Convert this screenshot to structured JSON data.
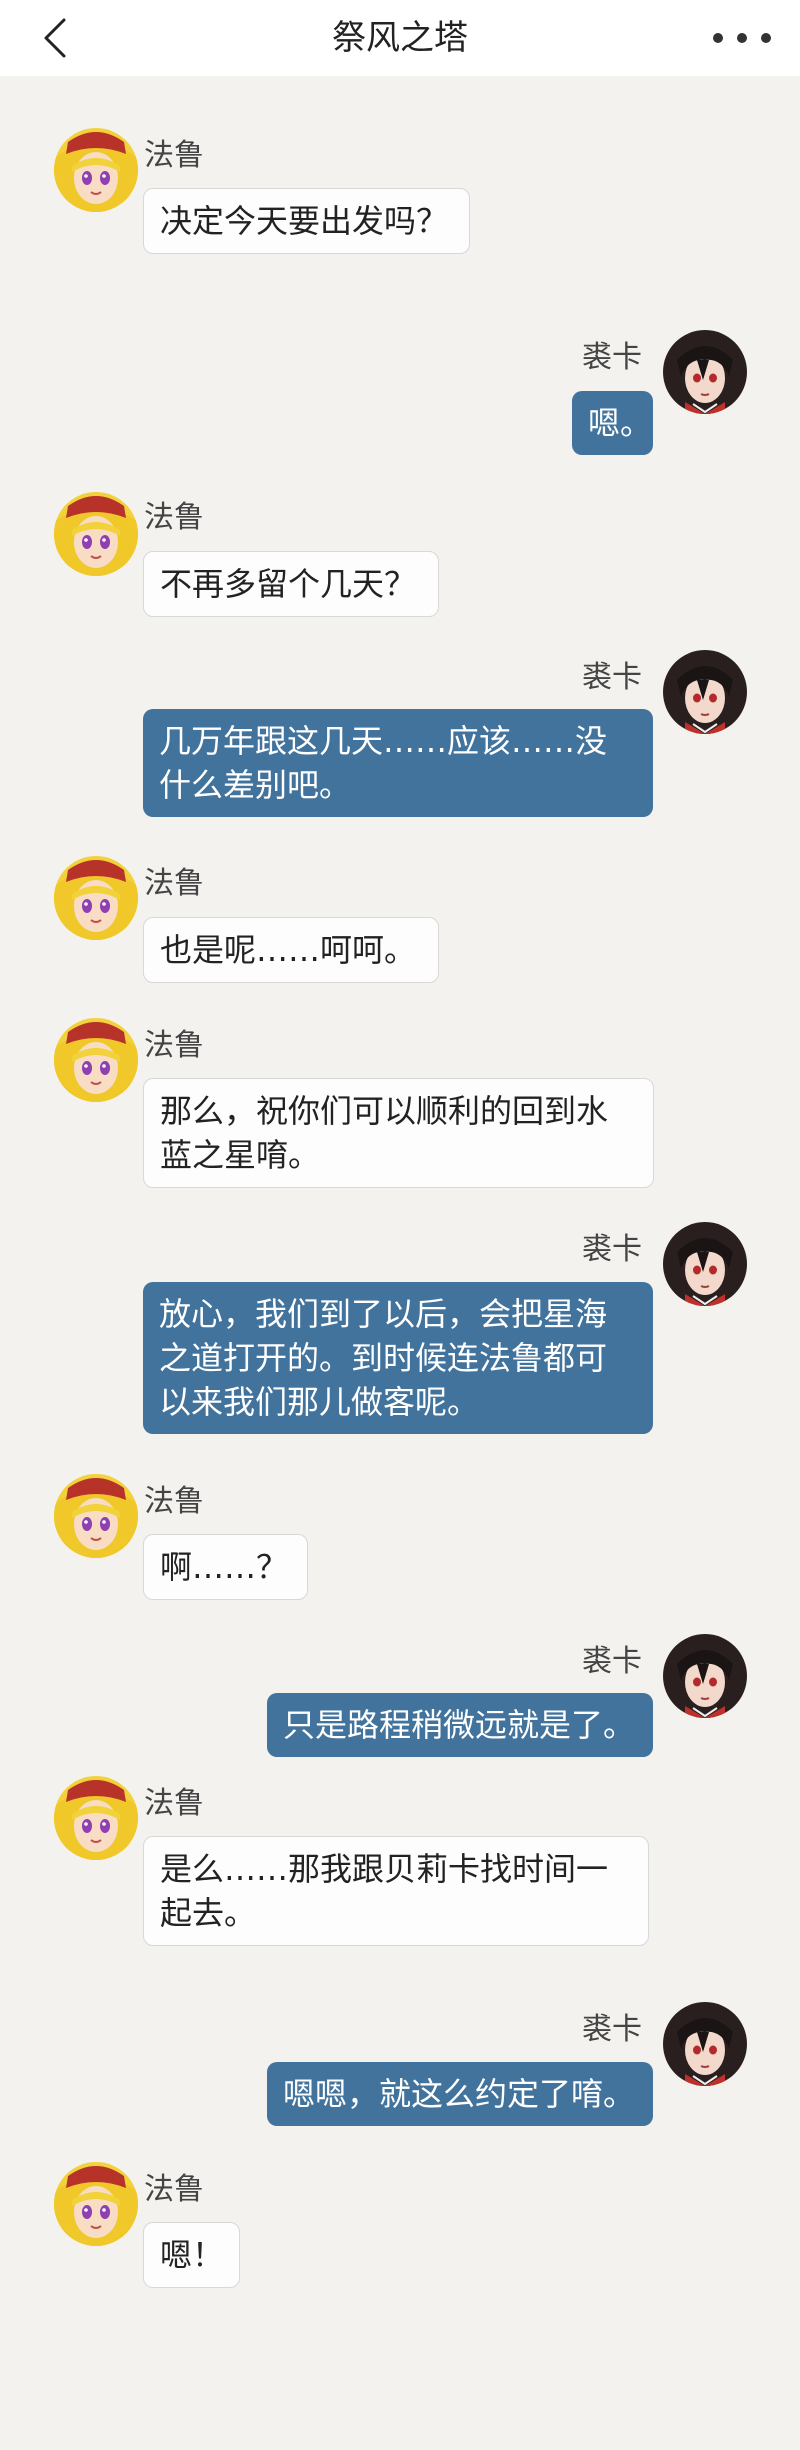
{
  "header": {
    "title": "祭风之塔",
    "back_icon": "chevron-left-icon",
    "more_icon": "more-dots-icon"
  },
  "colors": {
    "background": "#f3f2ee",
    "right_bubble": "#42739c",
    "left_bubble": "#fdfdfd"
  },
  "messages": [
    {
      "side": "left",
      "sender": "法鲁",
      "text": "决定今天要出发吗？"
    },
    {
      "side": "right",
      "sender": "裘卡",
      "text": "嗯。"
    },
    {
      "side": "left",
      "sender": "法鲁",
      "text": "不再多留个几天？"
    },
    {
      "side": "right",
      "sender": "裘卡",
      "text": "几万年跟这几天……应该……没什么差别吧。"
    },
    {
      "side": "left",
      "sender": "法鲁",
      "text": "也是呢……呵呵。"
    },
    {
      "side": "left",
      "sender": "法鲁",
      "text": "那么，祝你们可以顺利的回到水蓝之星唷。"
    },
    {
      "side": "right",
      "sender": "裘卡",
      "text": "放心，我们到了以后，会把星海之道打开的。到时候连法鲁都可以来我们那儿做客呢。"
    },
    {
      "side": "left",
      "sender": "法鲁",
      "text": "啊……？"
    },
    {
      "side": "right",
      "sender": "裘卡",
      "text": "只是路程稍微远就是了。"
    },
    {
      "side": "left",
      "sender": "法鲁",
      "text": "是么……那我跟贝莉卡找时间一起去。"
    },
    {
      "side": "right",
      "sender": "裘卡",
      "text": "嗯嗯，就这么约定了唷。"
    },
    {
      "side": "left",
      "sender": "法鲁",
      "text": "嗯！"
    }
  ]
}
